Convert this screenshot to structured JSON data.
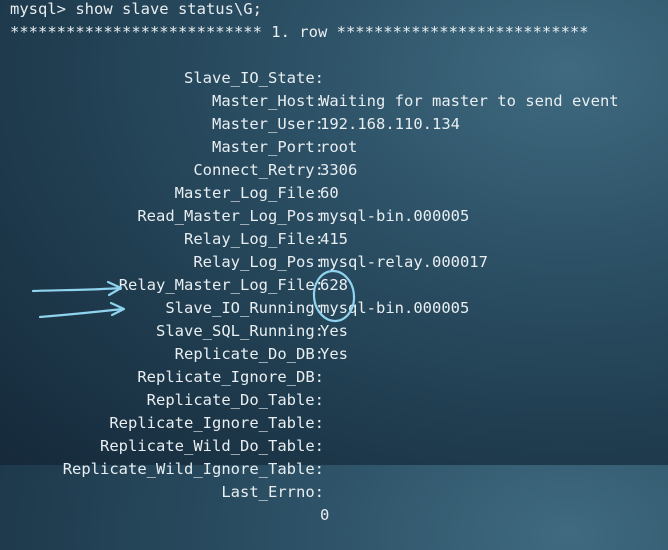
{
  "terminal": {
    "command_line": "mysql> show slave status\\G;",
    "row_header": "*************************** 1. row ***************************",
    "fields": [
      {
        "name": "Slave_IO_State",
        "value": "Waiting for master to send event"
      },
      {
        "name": "Master_Host",
        "value": "192.168.110.134"
      },
      {
        "name": "Master_User",
        "value": "root"
      },
      {
        "name": "Master_Port",
        "value": "3306"
      },
      {
        "name": "Connect_Retry",
        "value": "60"
      },
      {
        "name": "Master_Log_File",
        "value": "mysql-bin.000005"
      },
      {
        "name": "Read_Master_Log_Pos",
        "value": "415"
      },
      {
        "name": "Relay_Log_File",
        "value": "mysql-relay.000017"
      },
      {
        "name": "Relay_Log_Pos",
        "value": "628"
      },
      {
        "name": "Relay_Master_Log_File",
        "value": "mysql-bin.000005"
      },
      {
        "name": "Slave_IO_Running",
        "value": "Yes"
      },
      {
        "name": "Slave_SQL_Running",
        "value": "Yes"
      },
      {
        "name": "Replicate_Do_DB",
        "value": ""
      },
      {
        "name": "Replicate_Ignore_DB",
        "value": ""
      },
      {
        "name": "Replicate_Do_Table",
        "value": ""
      },
      {
        "name": "Replicate_Ignore_Table",
        "value": ""
      },
      {
        "name": "Replicate_Wild_Do_Table",
        "value": ""
      },
      {
        "name": "Replicate_Wild_Ignore_Table",
        "value": ""
      },
      {
        "name": "Last_Errno",
        "value": "0"
      }
    ]
  },
  "annotation": {
    "color": "#8fd3ee"
  }
}
